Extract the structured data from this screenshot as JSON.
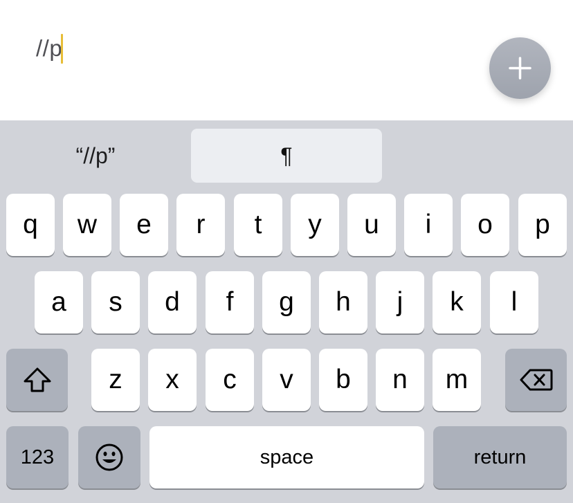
{
  "editor": {
    "text": "//p"
  },
  "suggestions": {
    "quoted": "“//p”",
    "main": "¶"
  },
  "keyboard": {
    "row1": [
      "q",
      "w",
      "e",
      "r",
      "t",
      "y",
      "u",
      "i",
      "o",
      "p"
    ],
    "row2": [
      "a",
      "s",
      "d",
      "f",
      "g",
      "h",
      "j",
      "k",
      "l"
    ],
    "row3": [
      "z",
      "x",
      "c",
      "v",
      "b",
      "n",
      "m"
    ],
    "numbers_label": "123",
    "space_label": "space",
    "return_label": "return"
  },
  "icons": {
    "add": "plus-icon",
    "shift": "shift-icon",
    "delete": "backspace-icon",
    "emoji": "emoji-icon"
  },
  "colors": {
    "caret": "#e7bd37",
    "keyboard_bg": "#d1d3d9",
    "function_key": "#acb1bb",
    "fab": "#a7abb4"
  }
}
